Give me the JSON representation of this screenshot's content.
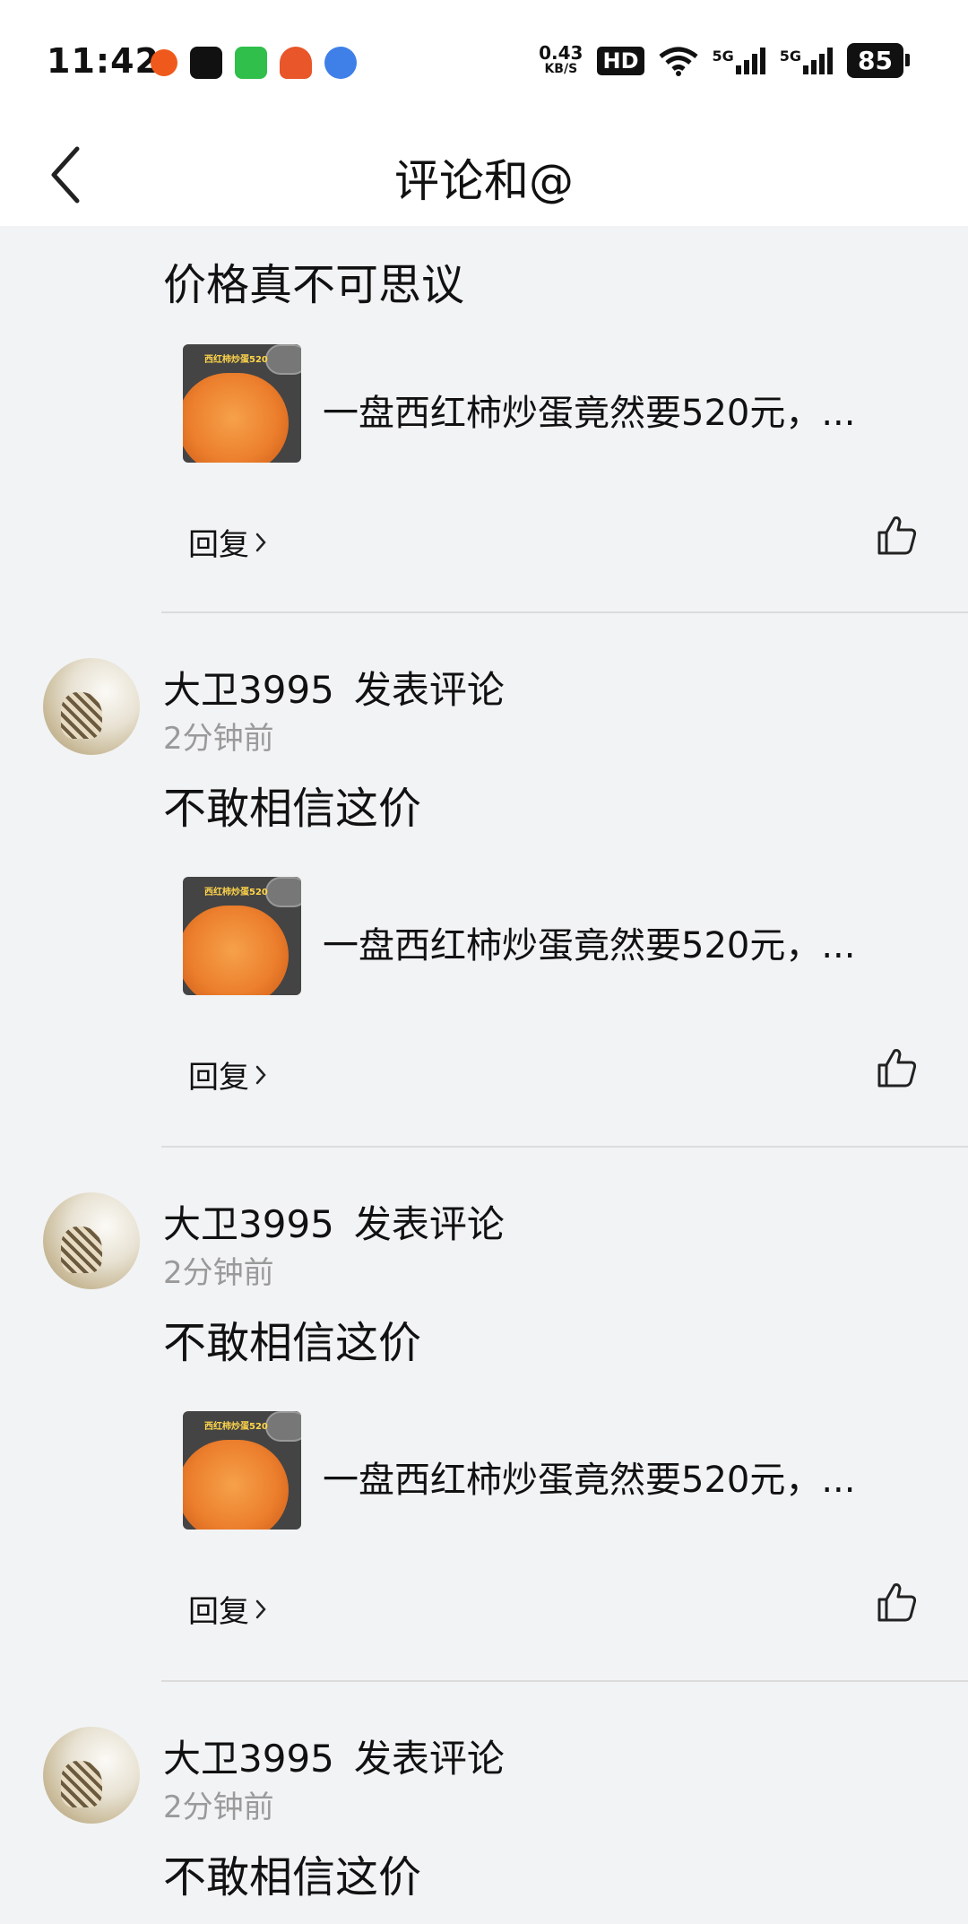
{
  "status_bar": {
    "time": "11:42",
    "net_speed_value": "0.43",
    "net_speed_unit": "KB/S",
    "hd": "HD",
    "sim1": "5G",
    "sim2": "5G",
    "battery": "85"
  },
  "header": {
    "title": "评论和@"
  },
  "first_item": {
    "comment": "价格真不可思议",
    "post": {
      "thumb_label": "西红柿炒蛋520",
      "title": "一盘西红柿炒蛋竟然要520元，..."
    },
    "reply_label": "回复"
  },
  "items": [
    {
      "user": "大卫3995",
      "action": "发表评论",
      "time": "2分钟前",
      "comment": "不敢相信这价",
      "post": {
        "thumb_label": "西红柿炒蛋520",
        "title": "一盘西红柿炒蛋竟然要520元，..."
      },
      "reply_label": "回复"
    },
    {
      "user": "大卫3995",
      "action": "发表评论",
      "time": "2分钟前",
      "comment": "不敢相信这价",
      "post": {
        "thumb_label": "西红柿炒蛋520",
        "title": "一盘西红柿炒蛋竟然要520元，..."
      },
      "reply_label": "回复"
    },
    {
      "user": "大卫3995",
      "action": "发表评论",
      "time": "2分钟前",
      "comment": "不敢相信这价"
    }
  ],
  "icons": {
    "back": "chevron-left-icon",
    "reply_arrow": "chevron-right-icon",
    "like": "thumbs-up-icon",
    "wifi": "wifi-icon"
  }
}
